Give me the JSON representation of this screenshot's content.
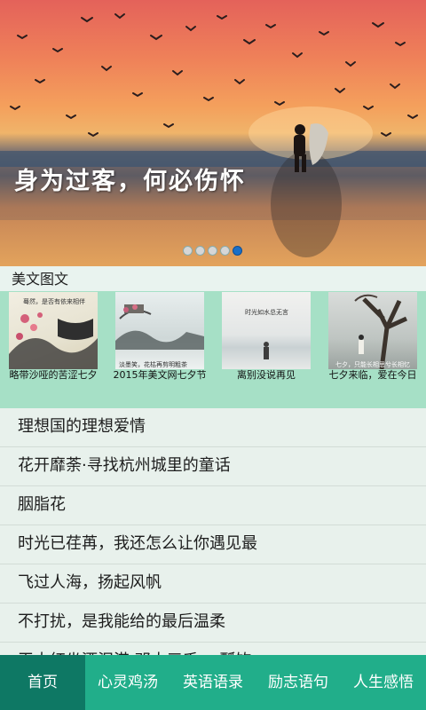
{
  "banner": {
    "caption": "身为过客，何必伤怀",
    "slide_count": 5,
    "active_slide": 5
  },
  "section": {
    "title": "美文图文"
  },
  "gallery": [
    {
      "label": "略带沙哑的苦涩七夕",
      "thumb_text": "蓦然，是否有依来相伴"
    },
    {
      "label": "2015年美文网七夕节",
      "thumb_text": "淡墨笑，花枯再剪明粗茶"
    },
    {
      "label": "离别没说再见",
      "thumb_text": "时光如水总无言"
    },
    {
      "label": "七夕来临，爱在今日",
      "thumb_text": "七夕，只能长相思兮长相忆"
    }
  ],
  "list": [
    "理想国的理想爱情",
    "花开靡荼·寻找杭州城里的童话",
    "胭脂花",
    "时光已荏苒，我还怎么让你遇见最",
    "飞过人海，扬起风帆",
    "不打扰，是我能给的最后温柔",
    "王大红坐酒泪港 邓大三千 一瓢饮"
  ],
  "tabs": [
    {
      "label": "首页",
      "active": true
    },
    {
      "label": "心灵鸡汤",
      "active": false
    },
    {
      "label": "英语语录",
      "active": false
    },
    {
      "label": "励志语句",
      "active": false
    },
    {
      "label": "人生感悟",
      "active": false
    }
  ],
  "colors": {
    "tab_bar": "#21ae8a",
    "tab_active": "#0e7864",
    "gallery_bg": "#a6e0c6",
    "dot_active": "#1a6fc7"
  }
}
